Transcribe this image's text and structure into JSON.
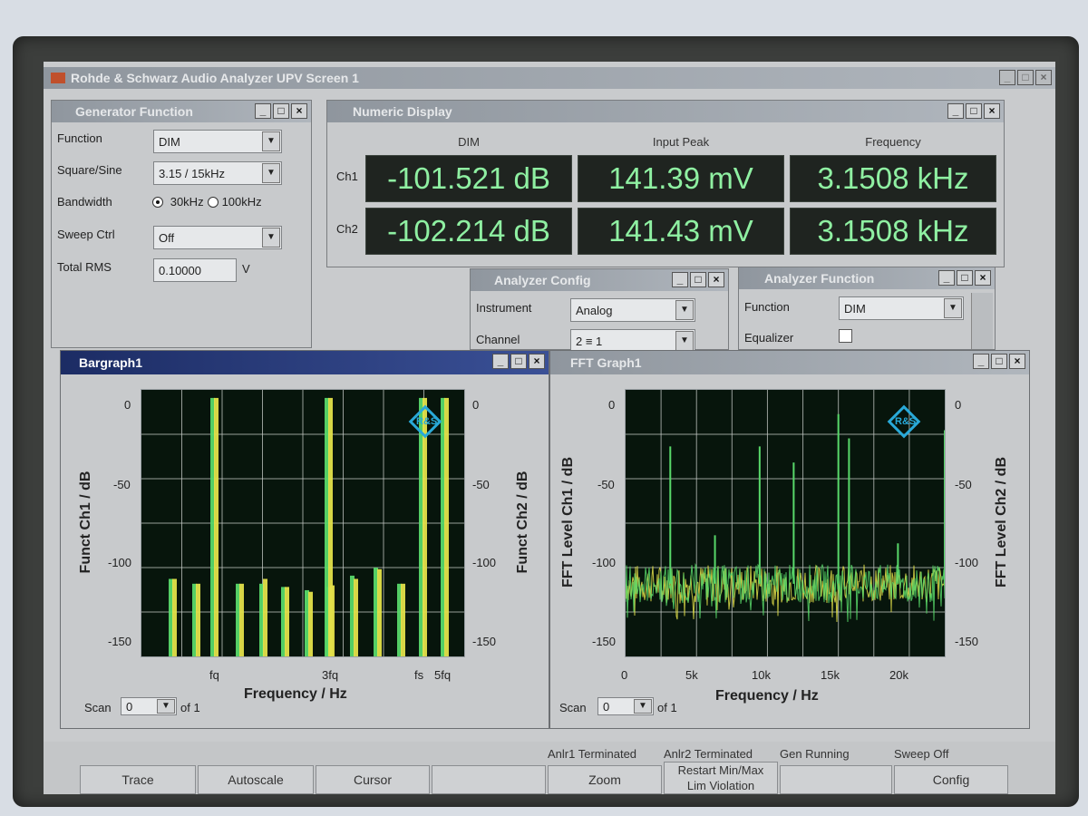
{
  "window": {
    "title": "Rohde & Schwarz Audio Analyzer UPV Screen 1"
  },
  "generator": {
    "title": "Generator Function",
    "rows": [
      {
        "label": "Function",
        "value": "DIM"
      },
      {
        "label": "Square/Sine",
        "value": "3.15 / 15kHz"
      },
      {
        "label": "Bandwidth",
        "option1": "30kHz",
        "option2": "100kHz",
        "selected": "30kHz"
      },
      {
        "label": "Sweep Ctrl",
        "value": "Off"
      },
      {
        "label": "Total RMS",
        "value": "0.10000",
        "unit": "V"
      }
    ]
  },
  "numeric": {
    "title": "Numeric Display",
    "headers": [
      "DIM",
      "Input Peak",
      "Frequency"
    ],
    "channels": [
      {
        "label": "Ch1",
        "values": [
          "-101.521 dB",
          "141.39 mV",
          "3.1508 kHz"
        ]
      },
      {
        "label": "Ch2",
        "values": [
          "-102.214 dB",
          "141.43 mV",
          "3.1508 kHz"
        ]
      }
    ]
  },
  "analyzer_config": {
    "title": "Analyzer Config",
    "rows": [
      {
        "label": "Instrument",
        "value": "Analog"
      },
      {
        "label": "Channel",
        "value": "2 ≡ 1"
      }
    ]
  },
  "analyzer_function": {
    "title": "Analyzer Function",
    "rows": [
      {
        "label": "Function",
        "value": "DIM"
      },
      {
        "label": "Equalizer",
        "checked": false
      }
    ]
  },
  "bargraph": {
    "title": "Bargraph1",
    "y_left_label": "Funct Ch1 / dB",
    "y_right_label": "Funct Ch2 / dB",
    "x_label": "Frequency / Hz",
    "y_ticks": [
      "0",
      "-50",
      "-100",
      "-150"
    ],
    "x_ticks": [
      "fq",
      "3fq",
      "fs",
      "5fq"
    ],
    "scan_label": "Scan",
    "scan_value": "0",
    "scan_of": "of 1"
  },
  "fft": {
    "title": "FFT Graph1",
    "y_left_label": "FFT Level Ch1 / dB",
    "y_right_label": "FFT Level Ch2 / dB",
    "x_label": "Frequency / Hz",
    "y_ticks": [
      "0",
      "-50",
      "-100",
      "-150"
    ],
    "x_ticks": [
      "0",
      "5k",
      "10k",
      "15k",
      "20k"
    ],
    "scan_label": "Scan",
    "scan_value": "0",
    "scan_of": "of 1"
  },
  "status": {
    "anlr1": "Anlr1 Terminated",
    "anlr2": "Anlr2 Terminated",
    "gen": "Gen Running",
    "sweep": "Sweep Off"
  },
  "softkeys": [
    {
      "label": "Trace"
    },
    {
      "label": "Autoscale"
    },
    {
      "label": "Cursor"
    },
    {
      "label": ""
    },
    {
      "label": "Zoom"
    },
    {
      "label": "Restart Min/Max\nLim Violation"
    },
    {
      "label": ""
    },
    {
      "label": "Config"
    }
  ],
  "colors": {
    "trace_ch1": "#58d86a",
    "trace_ch2": "#e3e04a",
    "plot_bg": "#07150c",
    "title_active": "#1c2c64",
    "numeric_text": "#8ff0a2"
  },
  "chart_data": [
    {
      "type": "bar",
      "title": "Bargraph1",
      "xlabel": "Frequency / Hz",
      "ylabel": "Funct Ch1 / dB",
      "ylim": [
        -160,
        5
      ],
      "x_tick_labels": [
        "fq",
        "3fq",
        "fs",
        "5fq"
      ],
      "series": [
        {
          "name": "Ch1",
          "values": [
            -112,
            -115,
            0,
            -115,
            -115,
            -117,
            -119,
            -117,
            0,
            -110,
            -105,
            -115,
            0,
            0
          ]
        },
        {
          "name": "Ch2",
          "values": [
            -112,
            -115,
            0,
            -115,
            -112,
            -117,
            -120,
            -116,
            0,
            -112,
            -106,
            -115,
            0,
            0
          ]
        }
      ]
    },
    {
      "type": "line",
      "title": "FFT Graph1",
      "xlabel": "Frequency / Hz",
      "ylabel": "FFT Level Ch1 / dB",
      "xlim": [
        0,
        22500
      ],
      "ylim": [
        -160,
        5
      ],
      "noise_floor_db": -115,
      "peaks": [
        {
          "x": 3150,
          "y": -30
        },
        {
          "x": 6300,
          "y": -85
        },
        {
          "x": 9450,
          "y": -30
        },
        {
          "x": 11850,
          "y": -40
        },
        {
          "x": 15000,
          "y": -10
        },
        {
          "x": 15750,
          "y": -25
        },
        {
          "x": 19200,
          "y": -90
        },
        {
          "x": 22500,
          "y": -20
        }
      ]
    }
  ]
}
